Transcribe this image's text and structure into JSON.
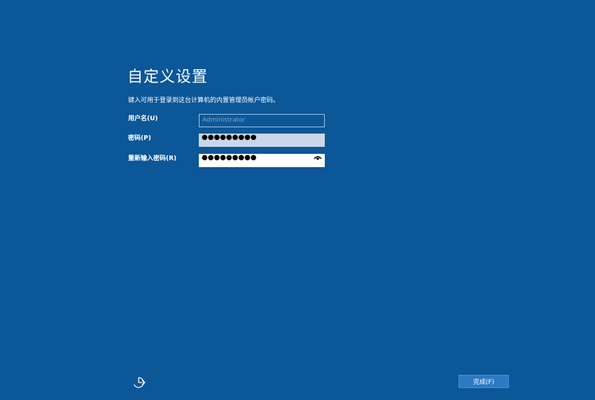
{
  "page": {
    "title": "自定义设置",
    "description": "键入可用于登录到这台计算机的内置管理员帐户密码。"
  },
  "form": {
    "username": {
      "label": "用户名(U)",
      "placeholder": "Administrator",
      "value": ""
    },
    "password": {
      "label": "密码(P)",
      "masked_value": "●●●●●●●●●"
    },
    "confirm_password": {
      "label": "重新输入密码(R)",
      "masked_value": "●●●●●●●●●",
      "reveal_icon": "eye-icon"
    }
  },
  "footer": {
    "accessibility_icon": "ease-of-access-icon",
    "finish_label": "完成(F)"
  },
  "colors": {
    "background": "#0b5798",
    "button": "#2d7ac4",
    "field_filled": "#c9d8e8",
    "field_border": "#9ec4e8"
  }
}
